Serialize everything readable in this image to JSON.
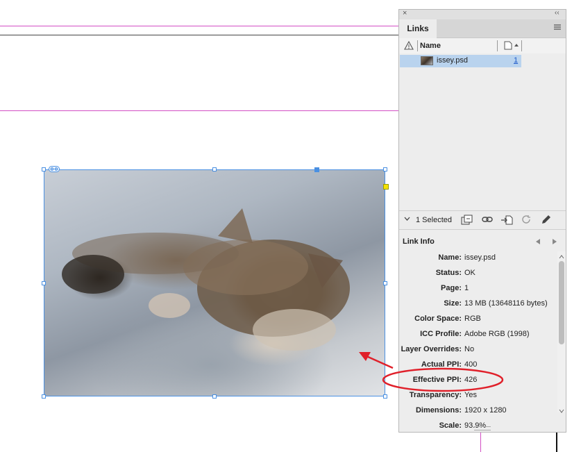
{
  "canvas": {
    "image_alt": "Tabby kitten sleeping on a gray knit blanket"
  },
  "panel": {
    "tab_label": "Links",
    "list": {
      "col_name": "Name",
      "items": [
        {
          "name": "issey.psd",
          "page": "1"
        }
      ]
    },
    "toolbar": {
      "selected_count": "1 Selected"
    },
    "link_info": {
      "title": "Link Info",
      "rows": [
        {
          "label": "Name:",
          "value": "issey.psd"
        },
        {
          "label": "Status:",
          "value": "OK"
        },
        {
          "label": "Page:",
          "value": "1"
        },
        {
          "label": "Size:",
          "value": "13 MB (13648116 bytes)"
        },
        {
          "label": "Color Space:",
          "value": "RGB"
        },
        {
          "label": "ICC Profile:",
          "value": "Adobe RGB (1998)"
        },
        {
          "label": "Layer Overrides:",
          "value": "No"
        },
        {
          "label": "Actual PPI:",
          "value": "400"
        },
        {
          "label": "Effective PPI:",
          "value": "426"
        },
        {
          "label": "Transparency:",
          "value": "Yes"
        },
        {
          "label": "Dimensions:",
          "value": "1920 x 1280"
        },
        {
          "label": "Scale:",
          "value": "93.9%"
        }
      ]
    }
  },
  "colors": {
    "selection": "#b9d3ee",
    "frame": "#4a90e2",
    "annotation": "#e0202a",
    "guide_magenta": "#d24ec4"
  }
}
